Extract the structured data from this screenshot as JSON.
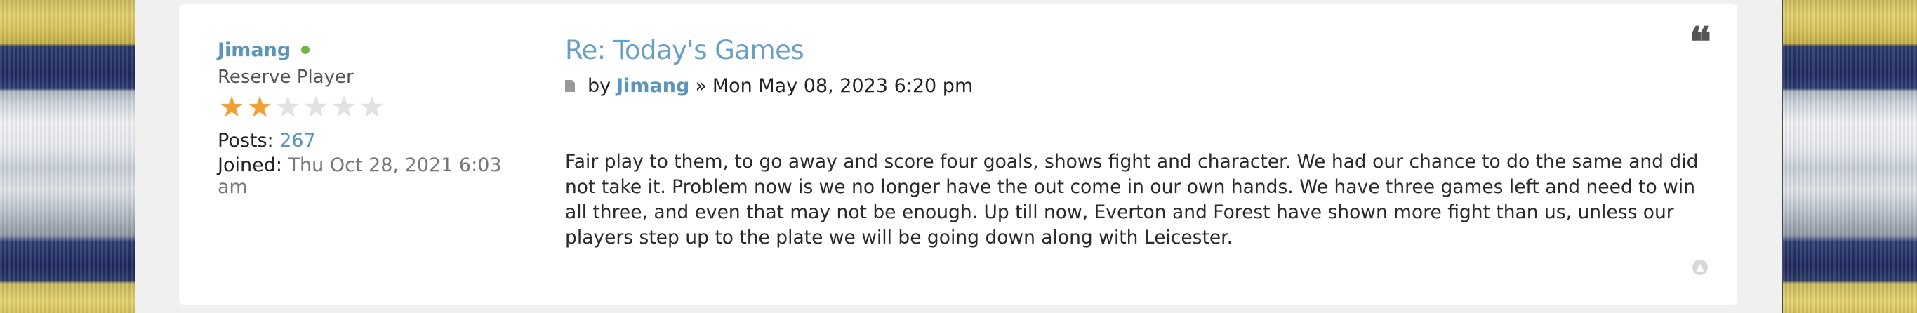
{
  "profile": {
    "username": "Jimang",
    "rank": "Reserve Player",
    "rank_stars": {
      "filled": 2,
      "total": 6
    },
    "posts_label": "Posts:",
    "posts_value": "267",
    "joined_label": "Joined:",
    "joined_value": "Thu Oct 28, 2021 6:03 am"
  },
  "post": {
    "title": "Re: Today's Games",
    "by_label": "by",
    "author": "Jimang",
    "separator": "»",
    "date": "Mon May 08, 2023 6:20 pm",
    "content": "Fair play to them, to go away and score four goals, shows fight and character. We had our chance to do the same and did not take it. Problem now is we no longer have the out come in our own hands. We have three games left and need to win all three, and even that may not be enough. Up till now, Everton and Forest have shown more fight than us, unless our players step up to the plate we will be going down along with Leicester."
  },
  "icons": {
    "online": "online-status-icon",
    "post": "post-icon",
    "quote": "quote-icon",
    "back_to_top": "back-to-top-icon"
  },
  "colors": {
    "link": "#5b95bb",
    "title": "#6a9fc4",
    "online": "#71b346",
    "star": "#f0a030"
  }
}
